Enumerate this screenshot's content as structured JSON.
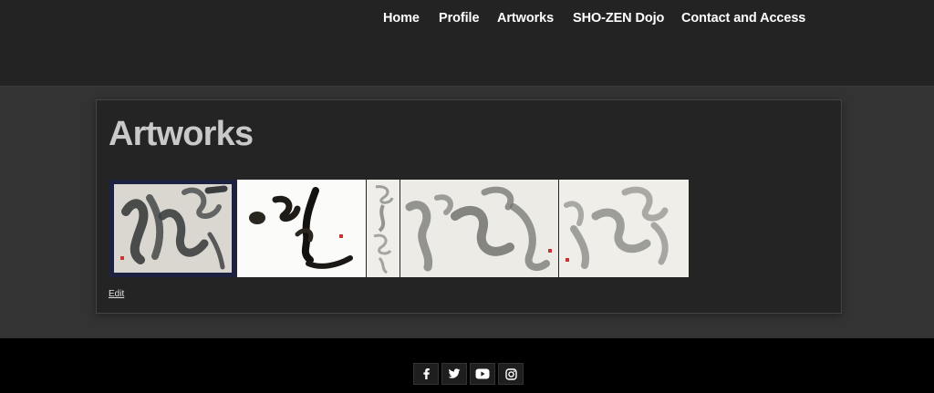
{
  "header": {
    "nav": [
      {
        "label": "Home"
      },
      {
        "label": "Profile"
      },
      {
        "label": "Artworks"
      },
      {
        "label": "SHO-ZEN Dojo"
      },
      {
        "label": "Contact and Access"
      }
    ]
  },
  "main": {
    "title": "Artworks",
    "edit_label": "Edit",
    "gallery": [
      {
        "name": "calligraphy-artwork-1"
      },
      {
        "name": "calligraphy-artwork-2"
      },
      {
        "name": "calligraphy-artwork-3"
      },
      {
        "name": "calligraphy-artwork-4"
      },
      {
        "name": "calligraphy-artwork-5"
      }
    ]
  },
  "footer": {
    "social": [
      {
        "icon": "facebook-icon"
      },
      {
        "icon": "twitter-icon"
      },
      {
        "icon": "youtube-icon"
      },
      {
        "icon": "instagram-icon"
      }
    ]
  },
  "colors": {
    "header_bg": "#232323",
    "page_bg": "#333333",
    "card_bg": "#242424",
    "footer_bg": "#000000",
    "title_color": "#c9c9c9",
    "nav_text": "#ffffff"
  }
}
